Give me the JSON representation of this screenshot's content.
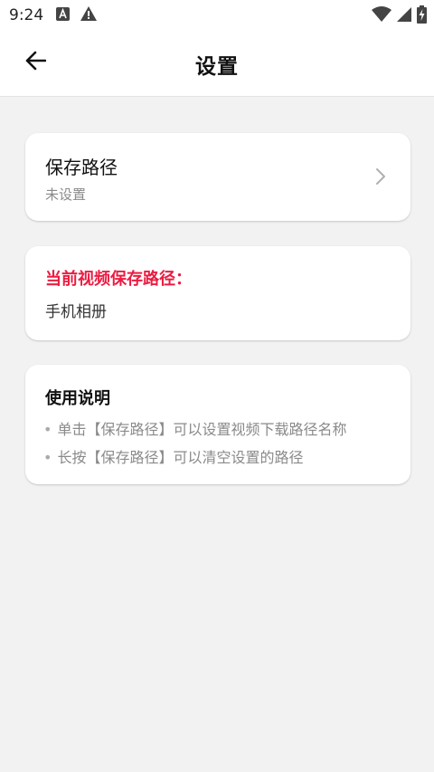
{
  "status_bar": {
    "time": "9:24",
    "icons": [
      "font-a-icon",
      "warning-icon",
      "wifi-icon",
      "signal-icon",
      "battery-charging-icon"
    ]
  },
  "app_bar": {
    "title": "设置",
    "back_icon": "arrow-left-icon"
  },
  "save_path_card": {
    "title": "保存路径",
    "value": "未设置",
    "chevron_icon": "chevron-right-icon"
  },
  "current_path_card": {
    "label": "当前视频保存路径：",
    "value": "手机相册",
    "label_color": "#ec1c42"
  },
  "usage_card": {
    "title": "使用说明",
    "bullet": "•",
    "items": [
      "单击【保存路径】可以设置视频下载路径名称",
      "长按【保存路径】可以清空设置的路径"
    ]
  }
}
